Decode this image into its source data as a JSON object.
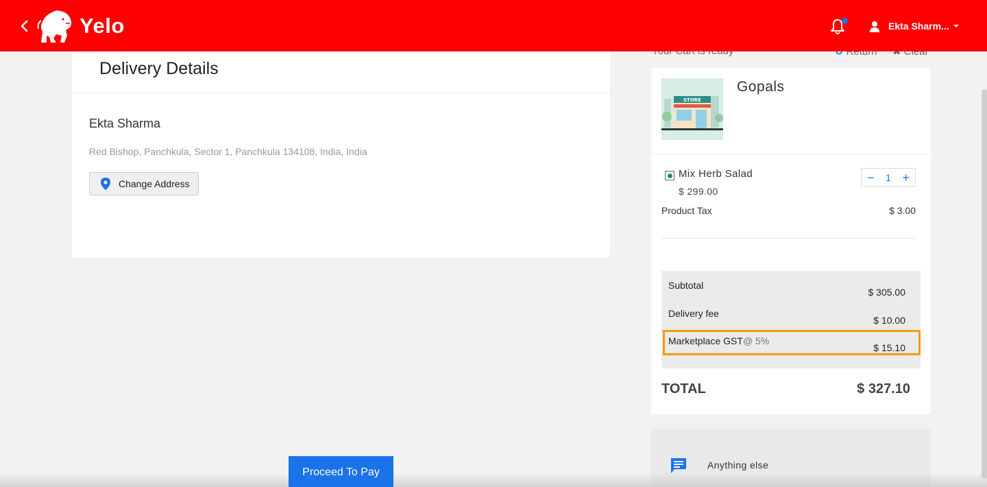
{
  "header": {
    "brand": "Yelo",
    "user_name": "Ekta Sharm...",
    "colors": {
      "bar": "#ff0000",
      "accent": "#1a73e8",
      "highlight": "#f59a0c"
    }
  },
  "delivery": {
    "title": "Delivery Details",
    "customer_name": "Ekta Sharma",
    "address": "Red Bishop, Panchkula, Sector 1, Panchkula 134108, India, India",
    "change_address_label": "Change Address"
  },
  "cart_header": {
    "ready_text": "Your Cart is ready",
    "return_label": "Return",
    "clear_label": "Clear"
  },
  "cart": {
    "store_name": "Gopals",
    "store_sign": "STORE",
    "item": {
      "name": "Mix Herb Salad",
      "price": "$ 299.00",
      "quantity": "1"
    },
    "product_tax": {
      "label": "Product Tax",
      "value": "$ 3.00"
    },
    "summary": {
      "subtotal": {
        "label": "Subtotal",
        "value": "$ 305.00"
      },
      "delivery_fee": {
        "label": "Delivery fee",
        "value": "$ 10.00"
      },
      "gst": {
        "label": "Marketplace GST",
        "rate": "@ 5%",
        "value": "$ 15.10"
      }
    },
    "total": {
      "label": "TOTAL",
      "value": "$ 327.10"
    }
  },
  "anything_else": {
    "label": "Anything else"
  },
  "proceed": {
    "label": "Proceed To Pay"
  }
}
